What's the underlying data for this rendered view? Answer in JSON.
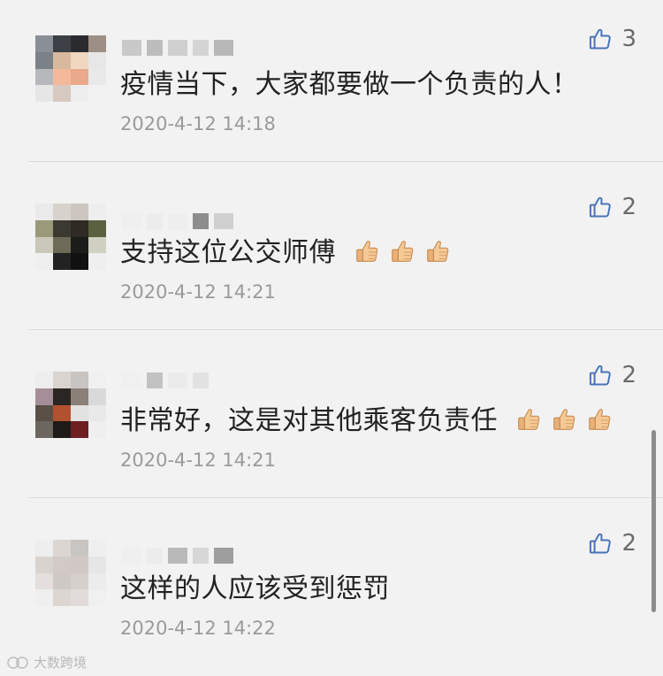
{
  "comments": [
    {
      "text": "疫情当下，大家都要做一个负责的人！",
      "time": "2020-4-12 14:18",
      "likes": "3",
      "emoji_count": 0
    },
    {
      "text": "支持这位公交师傅",
      "time": "2020-4-12 14:21",
      "likes": "2",
      "emoji_count": 3
    },
    {
      "text": "非常好，这是对其他乘客负责任",
      "time": "2020-4-12 14:21",
      "likes": "2",
      "emoji_count": 3
    },
    {
      "text": "这样的人应该受到惩罚",
      "time": "2020-4-12 14:22",
      "likes": "2",
      "emoji_count": 0
    }
  ],
  "icons": {
    "like": "thumbs-up-outline-icon",
    "emoji": "thumbs-up-emoji-icon"
  },
  "colors": {
    "like_icon": "#4a74b8",
    "timestamp": "#9a9a9a",
    "text": "#222222",
    "background": "#f2f2f2"
  },
  "watermark": {
    "text": "大数跨境"
  }
}
